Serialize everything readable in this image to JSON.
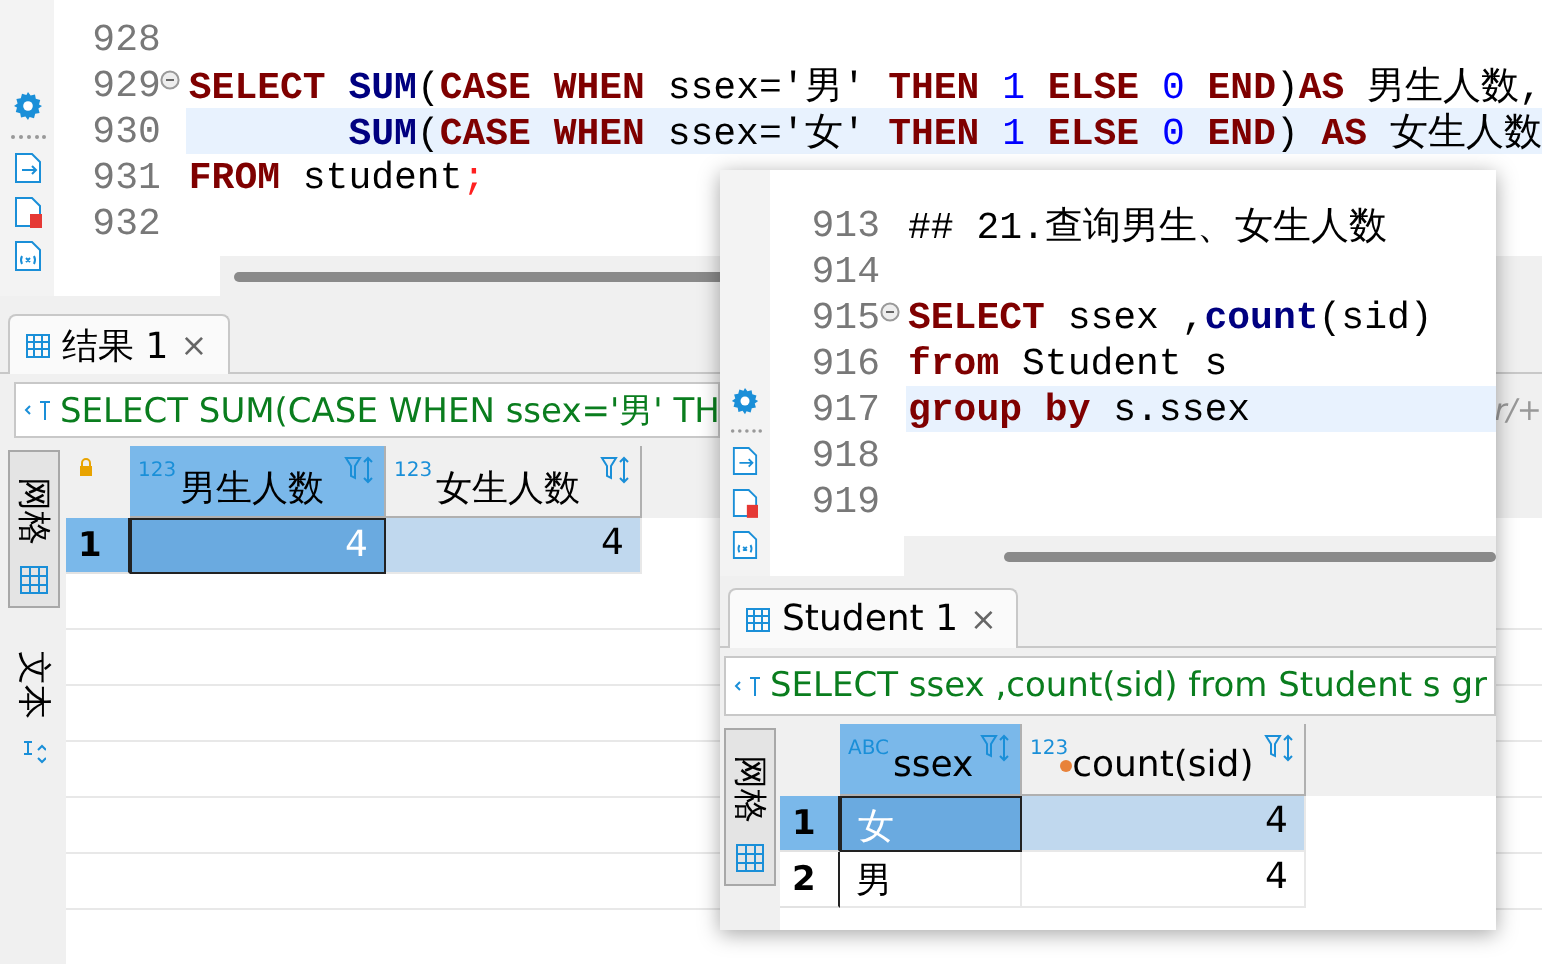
{
  "main_editor": {
    "lines": [
      {
        "number": "928",
        "fold": false,
        "current": false
      },
      {
        "number": "929",
        "fold": true,
        "current": false,
        "tokens": [
          {
            "kind": "kw",
            "text": "SELECT "
          },
          {
            "kind": "fn",
            "text": "SUM"
          },
          {
            "kind": "plain",
            "text": "("
          },
          {
            "kind": "kw",
            "text": "CASE WHEN"
          },
          {
            "kind": "plain",
            "text": " ssex="
          },
          {
            "kind": "str",
            "text": "'男'"
          },
          {
            "kind": "kw",
            "text": " THEN "
          },
          {
            "kind": "num",
            "text": "1"
          },
          {
            "kind": "kw",
            "text": " ELSE "
          },
          {
            "kind": "num",
            "text": "0"
          },
          {
            "kind": "kw",
            "text": " END"
          },
          {
            "kind": "plain",
            "text": ")"
          },
          {
            "kind": "kw",
            "text": "AS"
          },
          {
            "kind": "plain",
            "text": " 男生人数,"
          }
        ]
      },
      {
        "number": "930",
        "fold": false,
        "current": true,
        "tokens": [
          {
            "kind": "fn",
            "text": "       SUM"
          },
          {
            "kind": "plain",
            "text": "("
          },
          {
            "kind": "kw",
            "text": "CASE WHEN"
          },
          {
            "kind": "plain",
            "text": " ssex="
          },
          {
            "kind": "str",
            "text": "'女'"
          },
          {
            "kind": "kw",
            "text": " THEN "
          },
          {
            "kind": "num",
            "text": "1"
          },
          {
            "kind": "kw",
            "text": " ELSE "
          },
          {
            "kind": "num",
            "text": "0"
          },
          {
            "kind": "kw",
            "text": " END"
          },
          {
            "kind": "plain",
            "text": ")"
          },
          {
            "kind": "kw",
            "text": " AS"
          },
          {
            "kind": "plain",
            "text": " 女生人数"
          }
        ]
      },
      {
        "number": "931",
        "fold": false,
        "current": false,
        "tokens": [
          {
            "kind": "kw",
            "text": "FROM"
          },
          {
            "kind": "plain",
            "text": " student"
          },
          {
            "kind": "err",
            "text": ";"
          }
        ]
      },
      {
        "number": "932",
        "fold": false,
        "current": false
      }
    ]
  },
  "main_results": {
    "tab": {
      "label": "结果 1",
      "close": "×",
      "selected": true
    },
    "query": "SELECT SUM(CASE WHEN ssex='男' TH",
    "filter_hint": "r/+",
    "view_tabs": [
      {
        "label": "网格",
        "selected": true
      },
      {
        "label": "文本",
        "selected": false
      }
    ],
    "columns": [
      {
        "type_label": "123",
        "name": "男生人数",
        "selected": true,
        "badge": false
      },
      {
        "type_label": "123",
        "name": "女生人数",
        "selected": false,
        "badge": false
      }
    ],
    "rows": [
      {
        "number": "1",
        "selected": true,
        "cells": [
          "4",
          "4"
        ]
      }
    ]
  },
  "overlay_window": {
    "editor": {
      "lines": [
        {
          "number": "913",
          "fold": false,
          "current": false,
          "tokens": [
            {
              "kind": "plain",
              "text": "## 21.查询男生、女生人数"
            }
          ]
        },
        {
          "number": "914",
          "fold": false,
          "current": false
        },
        {
          "number": "915",
          "fold": true,
          "current": false,
          "tokens": [
            {
              "kind": "kw",
              "text": "SELECT"
            },
            {
              "kind": "plain",
              "text": " ssex ,"
            },
            {
              "kind": "fn",
              "text": "count"
            },
            {
              "kind": "plain",
              "text": "(sid)"
            }
          ]
        },
        {
          "number": "916",
          "fold": false,
          "current": false,
          "tokens": [
            {
              "kind": "kw",
              "text": "from"
            },
            {
              "kind": "plain",
              "text": " Student s"
            }
          ]
        },
        {
          "number": "917",
          "fold": false,
          "current": true,
          "tokens": [
            {
              "kind": "kw",
              "text": "group by"
            },
            {
              "kind": "plain",
              "text": " s.ssex"
            }
          ]
        },
        {
          "number": "918",
          "fold": false,
          "current": false
        },
        {
          "number": "919",
          "fold": false,
          "current": false
        }
      ]
    },
    "results": {
      "tab": {
        "label": "Student 1",
        "close": "×",
        "selected": true
      },
      "query": "SELECT ssex ,count(sid) from Student s gr",
      "view_tabs": [
        {
          "label": "网格",
          "selected": true
        }
      ],
      "columns": [
        {
          "type_label": "ABC",
          "name": "ssex",
          "selected": true,
          "badge": false
        },
        {
          "type_label": "123",
          "name": "count(sid)",
          "selected": false,
          "badge": true
        }
      ],
      "rows": [
        {
          "number": "1",
          "selected": true,
          "cells": [
            "女",
            "4"
          ]
        },
        {
          "number": "2",
          "selected": false,
          "cells": [
            "男",
            "4"
          ]
        }
      ]
    }
  }
}
